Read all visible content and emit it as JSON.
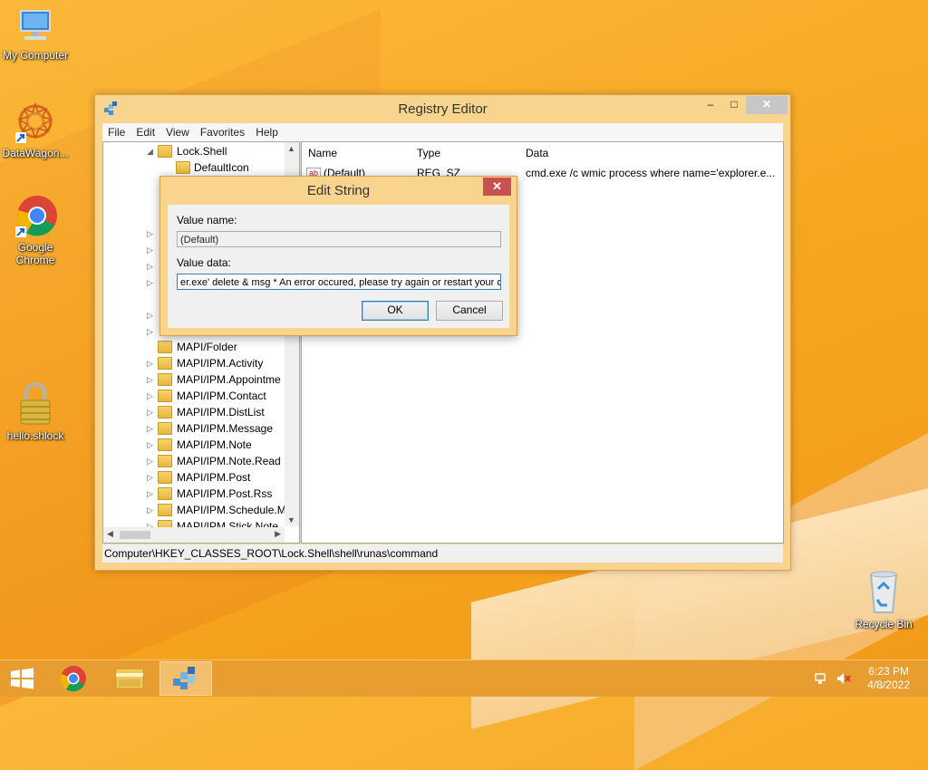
{
  "desktop": {
    "icons": [
      {
        "label": "My Computer",
        "icon": "computer-icon"
      },
      {
        "label": "DataWagon...",
        "icon": "datawagon-shortcut-icon"
      },
      {
        "label": "Google Chrome",
        "icon": "chrome-shortcut-icon"
      },
      {
        "label": "hello.shlock",
        "icon": "lock-file-icon"
      },
      {
        "label": "Recycle Bin",
        "icon": "recycle-bin-icon"
      }
    ]
  },
  "window": {
    "title": "Registry Editor",
    "min_glyph": "–",
    "max_glyph": "□",
    "close_glyph": "✕",
    "menu": [
      "File",
      "Edit",
      "View",
      "Favorites",
      "Help"
    ],
    "tree": [
      {
        "label": "Lock.Shell",
        "expander": "◢"
      },
      {
        "label": "DefaultIcon",
        "expander": ""
      },
      {
        "label": "MAPI/Folder",
        "expander": ""
      },
      {
        "label": "MAPI/IPM.Activity",
        "expander": "▷"
      },
      {
        "label": "MAPI/IPM.Appointme",
        "expander": "▷"
      },
      {
        "label": "MAPI/IPM.Contact",
        "expander": "▷"
      },
      {
        "label": "MAPI/IPM.DistList",
        "expander": "▷"
      },
      {
        "label": "MAPI/IPM.Message",
        "expander": "▷"
      },
      {
        "label": "MAPI/IPM.Note",
        "expander": "▷"
      },
      {
        "label": "MAPI/IPM.Note.Read",
        "expander": "▷"
      },
      {
        "label": "MAPI/IPM.Post",
        "expander": "▷"
      },
      {
        "label": "MAPI/IPM.Post.Rss",
        "expander": "▷"
      },
      {
        "label": "MAPI/IPM.Schedule.M",
        "expander": "▷"
      },
      {
        "label": "MAPI/IPM.Stick.Note",
        "expander": "▷"
      }
    ],
    "list": {
      "headers": [
        "Name",
        "Type",
        "Data"
      ],
      "rows": [
        {
          "name": "(Default)",
          "type": "REG_SZ",
          "data": "cmd.exe /c wmic process where name='explorer.e..."
        }
      ]
    },
    "status": "Computer\\HKEY_CLASSES_ROOT\\Lock.Shell\\shell\\runas\\command"
  },
  "dialog": {
    "title": "Edit String",
    "close_glyph": "✕",
    "value_name_label": "Value name:",
    "value_name": "(Default)",
    "value_data_label": "Value data:",
    "value_data": "er.exe' delete & msg * An error occured, please try again or restart your com",
    "ok_label": "OK",
    "cancel_label": "Cancel"
  },
  "taskbar": {
    "items": [
      "start-button",
      "chrome-taskbar-icon",
      "file-explorer-taskbar-icon",
      "registry-editor-taskbar-icon"
    ],
    "time": "6:23 PM",
    "date": "4/8/2022"
  }
}
